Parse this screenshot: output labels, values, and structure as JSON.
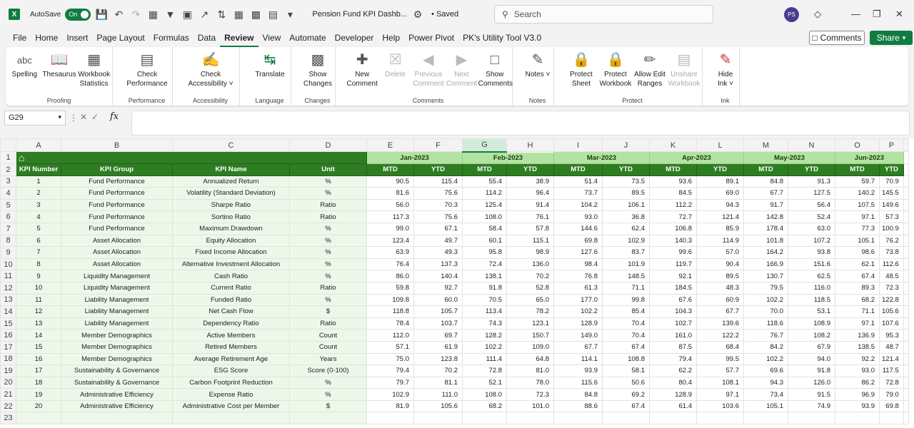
{
  "titlebar": {
    "autosave_label": "AutoSave",
    "autosave_state": "On",
    "document_title": "Pension Fund KPI Dashb...",
    "saved_state": "• Saved",
    "search_placeholder": "Search",
    "user_initials": "PS"
  },
  "menu": {
    "tabs": [
      "File",
      "Home",
      "Insert",
      "Page Layout",
      "Formulas",
      "Data",
      "Review",
      "View",
      "Automate",
      "Developer",
      "Help",
      "Power Pivot",
      "PK's Utility Tool V3.0"
    ],
    "active": "Review",
    "comments_label": "Comments",
    "share_label": "Share"
  },
  "ribbon": {
    "groups": [
      {
        "label": "Proofing",
        "buttons": [
          {
            "label": "Spelling",
            "icon": "spelling-icon"
          },
          {
            "label": "Thesaurus",
            "icon": "thesaurus-icon"
          },
          {
            "label": "Workbook Statistics",
            "icon": "workbook-statistics-icon"
          }
        ]
      },
      {
        "label": "Performance",
        "buttons": [
          {
            "label": "Check Performance",
            "icon": "check-performance-icon"
          }
        ]
      },
      {
        "label": "Accessibility",
        "buttons": [
          {
            "label": "Check Accessibility ˅",
            "icon": "check-accessibility-icon"
          }
        ]
      },
      {
        "label": "Language",
        "buttons": [
          {
            "label": "Translate",
            "icon": "translate-icon"
          }
        ]
      },
      {
        "label": "Changes",
        "buttons": [
          {
            "label": "Show Changes",
            "icon": "show-changes-icon"
          }
        ]
      },
      {
        "label": "Comments",
        "buttons": [
          {
            "label": "New Comment",
            "icon": "new-comment-icon"
          },
          {
            "label": "Delete",
            "icon": "delete-comment-icon",
            "disabled": true
          },
          {
            "label": "Previous Comment",
            "icon": "previous-comment-icon",
            "disabled": true
          },
          {
            "label": "Next Comment",
            "icon": "next-comment-icon",
            "disabled": true
          },
          {
            "label": "Show Comments",
            "icon": "show-comments-icon"
          }
        ]
      },
      {
        "label": "Notes",
        "buttons": [
          {
            "label": "Notes ˅",
            "icon": "notes-icon"
          }
        ]
      },
      {
        "label": "Protect",
        "buttons": [
          {
            "label": "Protect Sheet",
            "icon": "protect-sheet-icon"
          },
          {
            "label": "Protect Workbook",
            "icon": "protect-workbook-icon"
          },
          {
            "label": "Allow Edit Ranges",
            "icon": "allow-edit-ranges-icon"
          },
          {
            "label": "Unshare Workbook",
            "icon": "unshare-workbook-icon",
            "disabled": true
          }
        ]
      },
      {
        "label": "Ink",
        "buttons": [
          {
            "label": "Hide Ink ˅",
            "icon": "hide-ink-icon"
          }
        ]
      }
    ]
  },
  "formula_bar": {
    "name_box": "G29",
    "formula": ""
  },
  "grid": {
    "columns": [
      "A",
      "B",
      "C",
      "D",
      "E",
      "F",
      "G",
      "H",
      "I",
      "J",
      "K",
      "L",
      "M",
      "N",
      "O",
      "P"
    ],
    "selected_column": "G",
    "months": [
      "Jan-2023",
      "Feb-2023",
      "Mar-2023",
      "Apr-2023",
      "May-2023",
      "Jun-2023"
    ],
    "headers": [
      "KPI Number",
      "KPI Group",
      "KPI Name",
      "Unit"
    ],
    "mtd_label": "MTD",
    "ytd_label": "YTD",
    "rows": [
      {
        "n": "1",
        "group": "Fund Performance",
        "name": "Annualized Return",
        "unit": "%",
        "v": [
          "90.5",
          "115.4",
          "55.4",
          "38.9",
          "51.4",
          "73.5",
          "93.6",
          "89.1",
          "84.8",
          "91.3",
          "59.7",
          "70.9"
        ]
      },
      {
        "n": "2",
        "group": "Fund Performance",
        "name": "Volatility (Standard Deviation)",
        "unit": "%",
        "v": [
          "81.6",
          "75.6",
          "114.2",
          "96.4",
          "73.7",
          "89.5",
          "84.5",
          "69.0",
          "67.7",
          "127.5",
          "140.2",
          "145.5"
        ]
      },
      {
        "n": "3",
        "group": "Fund Performance",
        "name": "Sharpe Ratio",
        "unit": "Ratio",
        "v": [
          "56.0",
          "70.3",
          "125.4",
          "91.4",
          "104.2",
          "106.1",
          "112.2",
          "94.3",
          "91.7",
          "56.4",
          "107.5",
          "149.6"
        ]
      },
      {
        "n": "4",
        "group": "Fund Performance",
        "name": "Sortino Ratio",
        "unit": "Ratio",
        "v": [
          "117.3",
          "75.6",
          "108.0",
          "76.1",
          "93.0",
          "36.8",
          "72.7",
          "121.4",
          "142.8",
          "52.4",
          "97.1",
          "57.3"
        ]
      },
      {
        "n": "5",
        "group": "Fund Performance",
        "name": "Maximum Drawdown",
        "unit": "%",
        "v": [
          "99.0",
          "67.1",
          "58.4",
          "57.8",
          "144.6",
          "62.4",
          "106.8",
          "85.9",
          "178.4",
          "63.0",
          "77.3",
          "100.9"
        ]
      },
      {
        "n": "6",
        "group": "Asset Allocation",
        "name": "Equity Allocation",
        "unit": "%",
        "v": [
          "123.4",
          "49.7",
          "60.1",
          "115.1",
          "69.8",
          "102.9",
          "140.3",
          "114.9",
          "101.8",
          "107.2",
          "105.1",
          "76.2"
        ]
      },
      {
        "n": "7",
        "group": "Asset Allocation",
        "name": "Fixed Income Allocation",
        "unit": "%",
        "v": [
          "63.9",
          "49.3",
          "95.8",
          "98.9",
          "127.6",
          "83.7",
          "99.6",
          "57.0",
          "164.2",
          "93.8",
          "98.6",
          "73.8"
        ]
      },
      {
        "n": "8",
        "group": "Asset Allocation",
        "name": "Alternative Investment Allocation",
        "unit": "%",
        "v": [
          "76.4",
          "137.3",
          "72.4",
          "136.0",
          "98.4",
          "101.9",
          "119.7",
          "90.4",
          "166.9",
          "151.6",
          "62.1",
          "112.6"
        ]
      },
      {
        "n": "9",
        "group": "Liquidity Management",
        "name": "Cash Ratio",
        "unit": "%",
        "v": [
          "86.0",
          "140.4",
          "138.1",
          "70.2",
          "76.8",
          "148.5",
          "92.1",
          "89.5",
          "130.7",
          "62.5",
          "67.4",
          "48.5"
        ]
      },
      {
        "n": "10",
        "group": "Liquidity Management",
        "name": "Current Ratio",
        "unit": "Ratio",
        "v": [
          "59.8",
          "92.7",
          "91.8",
          "52.8",
          "61.3",
          "71.1",
          "184.5",
          "48.3",
          "79.5",
          "116.0",
          "89.3",
          "72.3"
        ]
      },
      {
        "n": "11",
        "group": "Liability Management",
        "name": "Funded Ratio",
        "unit": "%",
        "v": [
          "109.8",
          "60.0",
          "70.5",
          "65.0",
          "177.0",
          "99.8",
          "67.6",
          "60.9",
          "102.2",
          "118.5",
          "68.2",
          "122.8"
        ]
      },
      {
        "n": "12",
        "group": "Liability Management",
        "name": "Net Cash Flow",
        "unit": "$",
        "v": [
          "118.8",
          "105.7",
          "113.4",
          "78.2",
          "102.2",
          "85.4",
          "104.3",
          "67.7",
          "70.0",
          "53.1",
          "71.1",
          "105.6"
        ]
      },
      {
        "n": "13",
        "group": "Liability Management",
        "name": "Dependency Ratio",
        "unit": "Ratio",
        "v": [
          "78.4",
          "103.7",
          "74.3",
          "123.1",
          "128.9",
          "70.4",
          "102.7",
          "139.6",
          "118.6",
          "108.9",
          "97.1",
          "107.6"
        ]
      },
      {
        "n": "14",
        "group": "Member Demographics",
        "name": "Active Members",
        "unit": "Count",
        "v": [
          "112.0",
          "69.7",
          "128.2",
          "150.7",
          "149.0",
          "70.4",
          "161.0",
          "122.2",
          "76.7",
          "108.2",
          "136.9",
          "95.3"
        ]
      },
      {
        "n": "15",
        "group": "Member Demographics",
        "name": "Retired Members",
        "unit": "Count",
        "v": [
          "57.1",
          "61.9",
          "102.2",
          "109.0",
          "67.7",
          "67.4",
          "87.5",
          "68.4",
          "84.2",
          "67.9",
          "138.5",
          "48.7"
        ]
      },
      {
        "n": "16",
        "group": "Member Demographics",
        "name": "Average Retirement Age",
        "unit": "Years",
        "v": [
          "75.0",
          "123.8",
          "111.4",
          "64.8",
          "114.1",
          "108.8",
          "79.4",
          "99.5",
          "102.2",
          "94.0",
          "92.2",
          "121.4"
        ]
      },
      {
        "n": "17",
        "group": "Sustainability & Governance",
        "name": "ESG Score",
        "unit": "Score (0-100)",
        "v": [
          "79.4",
          "70.2",
          "72.8",
          "81.0",
          "93.9",
          "58.1",
          "62.2",
          "57.7",
          "69.6",
          "91.8",
          "93.0",
          "117.5"
        ]
      },
      {
        "n": "18",
        "group": "Sustainability & Governance",
        "name": "Carbon Footprint Reduction",
        "unit": "%",
        "v": [
          "79.7",
          "81.1",
          "52.1",
          "78.0",
          "115.6",
          "50.6",
          "80.4",
          "108.1",
          "94.3",
          "126.0",
          "86.2",
          "72.8"
        ]
      },
      {
        "n": "19",
        "group": "Administrative Efficiency",
        "name": "Expense Ratio",
        "unit": "%",
        "v": [
          "102.9",
          "111.0",
          "108.0",
          "72.3",
          "84.8",
          "69.2",
          "128.9",
          "97.1",
          "73.4",
          "91.5",
          "96.9",
          "79.0"
        ]
      },
      {
        "n": "20",
        "group": "Administrative Efficiency",
        "name": "Administrative Cost per Member",
        "unit": "$",
        "v": [
          "81.9",
          "105.6",
          "68.2",
          "101.0",
          "88.6",
          "67.4",
          "61.4",
          "103.6",
          "105.1",
          "74.9",
          "93.9",
          "69.8"
        ]
      }
    ]
  }
}
